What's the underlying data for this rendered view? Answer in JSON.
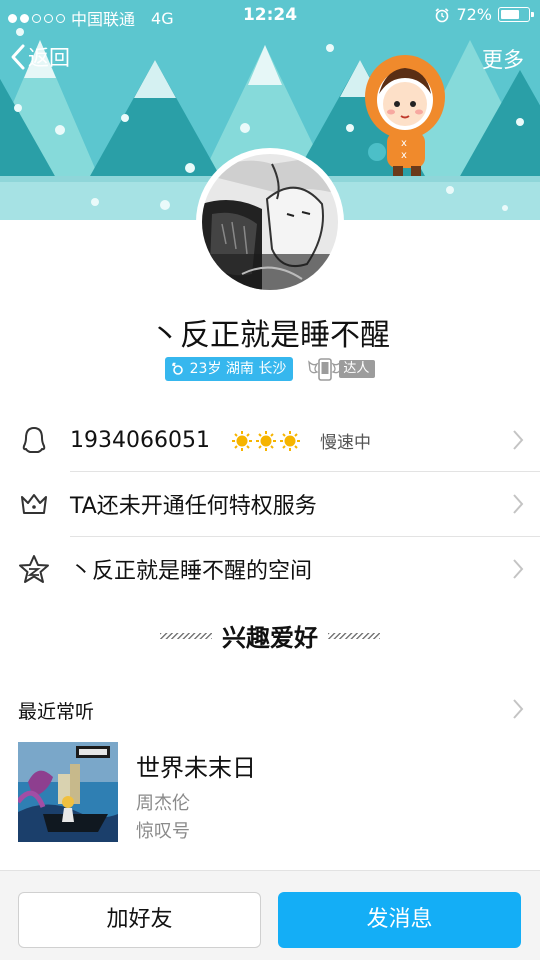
{
  "status_bar": {
    "carrier": "中国联通",
    "network": "4G",
    "time": "12:24",
    "battery": "72%",
    "battery_level": 0.72,
    "signal_bars_filled": 2,
    "signal_bars_total": 5
  },
  "nav": {
    "back_label": "返回",
    "more_label": "更多"
  },
  "profile": {
    "nickname": "丶反正就是睡不醒",
    "info_badge": "23岁 湖南 长沙",
    "daren_label": "达人"
  },
  "rows": {
    "qq_number": "1934066051",
    "level_status": "慢速中",
    "privilege_text": "TA还未开通任何特权服务",
    "space_text": "丶反正就是睡不醒的空间"
  },
  "interests": {
    "section_title": "兴趣爱好",
    "recent_label": "最近常听",
    "song_title": "世界未末日",
    "song_artist": "周杰伦",
    "song_album": "惊叹号"
  },
  "buttons": {
    "add_friend": "加好友",
    "send_message": "发消息"
  },
  "colors": {
    "banner_bg": "#5cc6cf",
    "accent_blue": "#14aef6",
    "badge_blue": "#36b7ee"
  }
}
